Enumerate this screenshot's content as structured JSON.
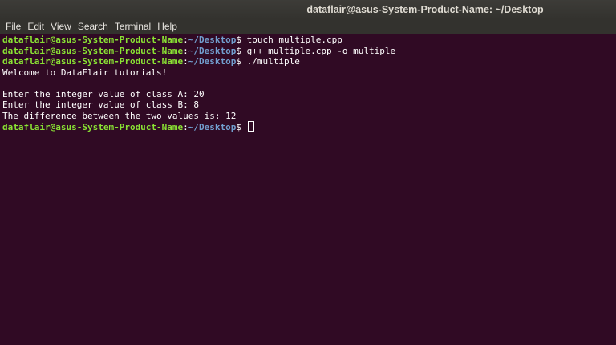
{
  "window": {
    "title": "dataflair@asus-System-Product-Name: ~/Desktop"
  },
  "menu": {
    "items": [
      "File",
      "Edit",
      "View",
      "Search",
      "Terminal",
      "Help"
    ]
  },
  "prompt": {
    "user_host": "dataflair@asus-System-Product-Name",
    "colon": ":",
    "path": "~/Desktop",
    "symbol": "$ "
  },
  "terminal": {
    "commands": [
      "touch multiple.cpp",
      "g++ multiple.cpp -o multiple",
      "./multiple"
    ],
    "output": [
      "Welcome to DataFlair tutorials!",
      "",
      "Enter the integer value of class A: 20",
      "Enter the integer value of class B: 8",
      "The difference between the two values is: 12"
    ]
  },
  "colors": {
    "background": "#300a24",
    "user_host": "#8ae234",
    "path": "#729fcf",
    "text": "#ffffff"
  }
}
